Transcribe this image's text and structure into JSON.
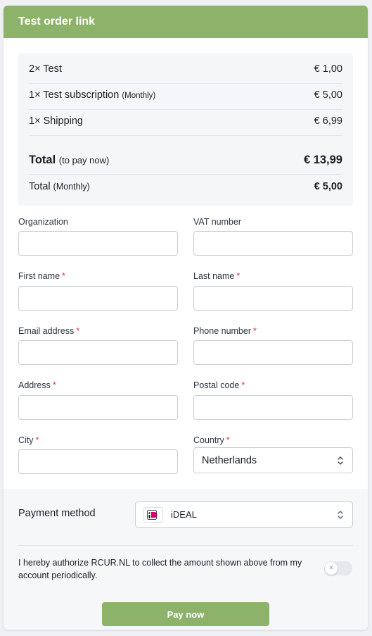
{
  "header": {
    "title": "Test order link"
  },
  "summary": {
    "items": [
      {
        "label": "2× Test",
        "sub": "",
        "value": "€ 1,00"
      },
      {
        "label": "1× Test subscription",
        "sub": "(Monthly)",
        "value": "€ 5,00"
      },
      {
        "label": "1× Shipping",
        "sub": "",
        "value": "€ 6,99"
      }
    ],
    "total": {
      "label": "Total",
      "sub": "(to pay now)",
      "value": "€ 13,99"
    },
    "recurring": {
      "label": "Total",
      "sub": "(Monthly)",
      "value": "€ 5,00"
    }
  },
  "form": {
    "required_mark": "*",
    "organization": {
      "label": "Organization",
      "value": ""
    },
    "vat": {
      "label": "VAT number",
      "value": ""
    },
    "first_name": {
      "label": "First name",
      "value": ""
    },
    "last_name": {
      "label": "Last name",
      "value": ""
    },
    "email": {
      "label": "Email address",
      "value": ""
    },
    "phone": {
      "label": "Phone number",
      "value": ""
    },
    "address": {
      "label": "Address",
      "value": ""
    },
    "postal_code": {
      "label": "Postal code",
      "value": ""
    },
    "city": {
      "label": "City",
      "value": ""
    },
    "country": {
      "label": "Country",
      "value": "Netherlands"
    }
  },
  "payment": {
    "label": "Payment method",
    "selected": "iDEAL",
    "logo_icon": "ideal-logo-icon"
  },
  "authorization": {
    "text": "I hereby authorize RCUR.NL to collect the amount shown above from my account periodically.",
    "enabled": false
  },
  "actions": {
    "pay_label": "Pay now"
  },
  "colors": {
    "brand": "#8db36b",
    "required": "#e0313b",
    "summary_bg": "#f5f6f8",
    "footer_bg": "#f6f7f9"
  }
}
